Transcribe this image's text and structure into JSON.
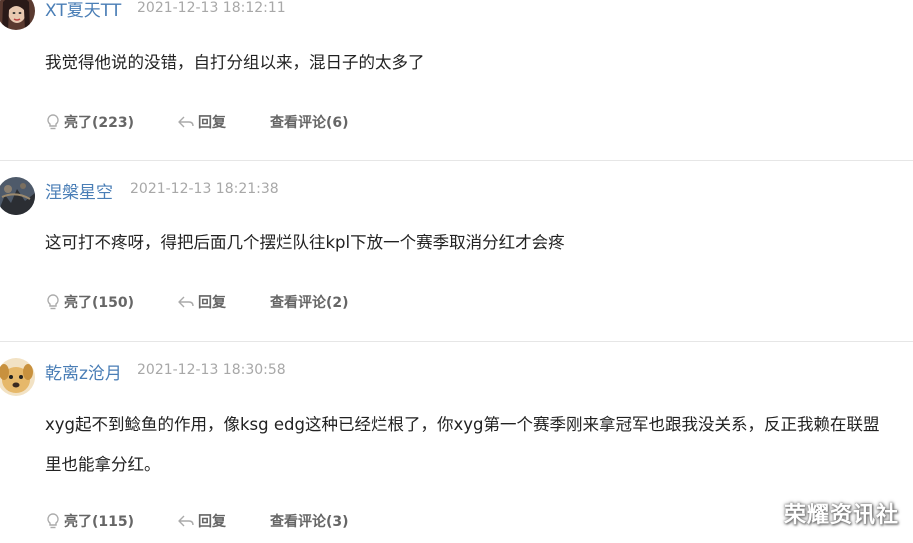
{
  "comments": [
    {
      "username": "XT夏天TT",
      "time": "2021-12-13 18:12:11",
      "text": "我觉得他说的没错，自打分组以来，混日子的太多了",
      "like_label": "亮了(223)",
      "reply_label": "回复",
      "view_label": "查看评论(6)"
    },
    {
      "username": "涅槃星空",
      "time": "2021-12-13 18:21:38",
      "text": "这可打不疼呀，得把后面几个摆烂队往kpl下放一个赛季取消分红才会疼",
      "like_label": "亮了(150)",
      "reply_label": "回复",
      "view_label": "查看评论(2)"
    },
    {
      "username": "乾离z沧月",
      "time": "2021-12-13 18:30:58",
      "text": "xyg起不到鲶鱼的作用，像ksg edg这种已经烂根了，你xyg第一个赛季刚来拿冠军也跟我没关系，反正我赖在联盟里也能拿分红。",
      "like_label": "亮了(115)",
      "reply_label": "回复",
      "view_label": "查看评论(3)"
    }
  ],
  "icons": {
    "like": "lightbulb-icon",
    "reply": "reply-arrow-icon"
  },
  "watermark": "荣耀资讯社",
  "colors": {
    "username": "#4a7eb6",
    "timestamp": "#a8a8a8",
    "body_text": "#222222",
    "action_text": "#666666",
    "divider": "#e6e6e6"
  }
}
